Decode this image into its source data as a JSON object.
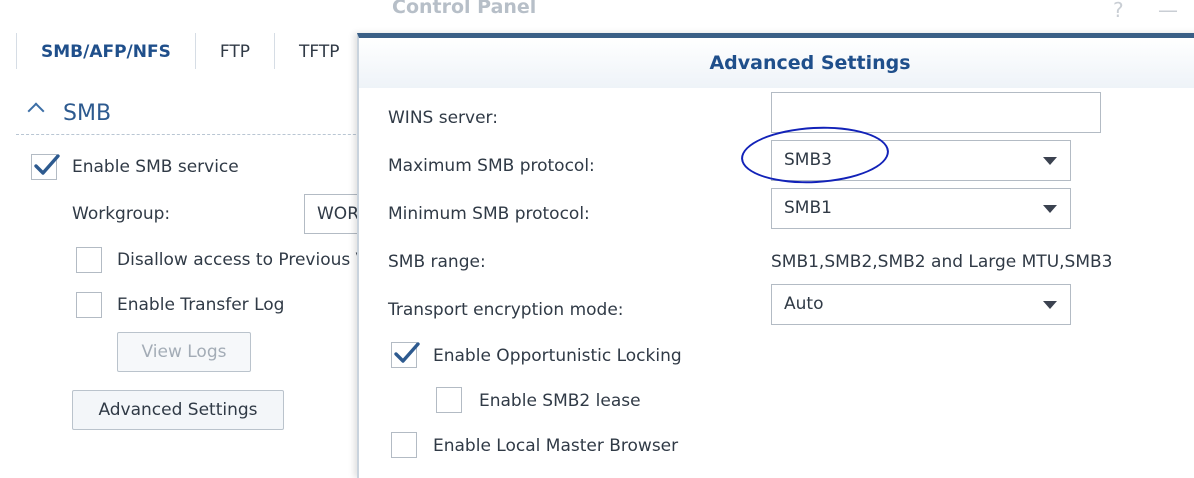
{
  "window": {
    "title": "Control Panel",
    "help_glyph": "?",
    "minimize_glyph": "—"
  },
  "tabs": [
    {
      "label": "SMB/AFP/NFS"
    },
    {
      "label": "FTP"
    },
    {
      "label": "TFTP"
    }
  ],
  "smb_section": {
    "title": "SMB",
    "enable_smb": {
      "label": "Enable SMB service",
      "checked": true
    },
    "workgroup": {
      "label": "Workgroup:",
      "value": "WORKGROUP"
    },
    "disallow_prev": {
      "label": "Disallow access to Previous Versions",
      "checked": false
    },
    "transfer_log": {
      "label": "Enable Transfer Log",
      "checked": false
    },
    "view_logs_label": "View Logs",
    "advanced_label": "Advanced Settings"
  },
  "dialog": {
    "title": "Advanced Settings",
    "wins": {
      "label": "WINS server:",
      "value": ""
    },
    "max_protocol": {
      "label": "Maximum SMB protocol:",
      "value": "SMB3"
    },
    "min_protocol": {
      "label": "Minimum SMB protocol:",
      "value": "SMB1"
    },
    "range": {
      "label": "SMB range:",
      "value": "SMB1,SMB2,SMB2 and Large MTU,SMB3"
    },
    "encryption": {
      "label": "Transport encryption mode:",
      "value": "Auto"
    },
    "oplock": {
      "label": "Enable Opportunistic Locking",
      "checked": true
    },
    "smb2_lease": {
      "label": "Enable SMB2 lease",
      "checked": false
    },
    "local_master": {
      "label": "Enable Local Master Browser",
      "checked": false
    }
  },
  "annotation": {
    "color": "#1222b8"
  },
  "colors": {
    "accent": "#1f4f8b",
    "dialog_border": "#3a5f86"
  }
}
